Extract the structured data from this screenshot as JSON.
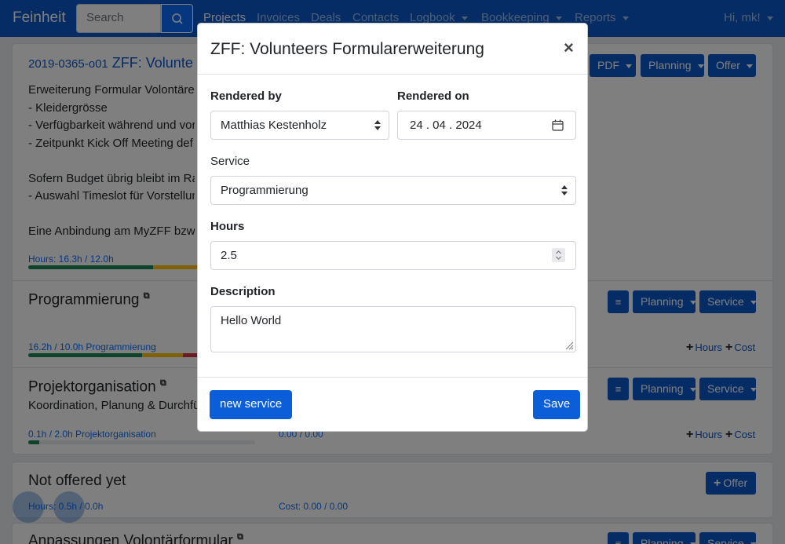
{
  "navbar": {
    "brand": "Feinheit",
    "search_placeholder": "Search",
    "links": [
      "Projects",
      "Invoices",
      "Deals",
      "Contacts",
      "Logbook",
      "Bookkeeping",
      "Reports"
    ],
    "user": "Hi, mk!"
  },
  "project": {
    "code": "2019-0365-o01",
    "title": "ZFF: Volunteers Formularerweiterung",
    "title_visible": "ZFF: Volunte",
    "description_lines": [
      "Erweiterung Formular Volontäre",
      "- Kleidergrösse",
      "- Verfügbarkeit während und vor",
      "- Zeitpunkt Kick Off Meeting def",
      "",
      "Sofern Budget übrig bleibt im Ra",
      "- Auswahl Timeslot für Vorstellun",
      "",
      "Eine Anbindung am MyZFF bzw."
    ],
    "hours": "Hours: 16.3h / 12.0h",
    "buttons": {
      "pdf": "PDF",
      "planning": "Planning",
      "offer": "Offer"
    }
  },
  "services": [
    {
      "title": "Programmierung",
      "hours_text": "16.2h / 10.0h Programmierung",
      "planning": "Planning",
      "service": "Service",
      "add_hours": "Hours",
      "add_cost": "Cost"
    },
    {
      "title": "Projektorganisation",
      "subtitle": "Koordination, Planung & Durchfü",
      "hours_text": "0.1h / 2.0h Projektorganisation",
      "cost_text": "0.00 / 0.00",
      "planning": "Planning",
      "service": "Service",
      "add_hours": "Hours",
      "add_cost": "Cost"
    }
  ],
  "not_offered": {
    "title": "Not offered yet",
    "hours": "Hours: 0.5h / 0.0h",
    "cost": "Cost: 0.00 / 0.00",
    "offer_button": "Offer"
  },
  "last_row": {
    "title": "Anpassungen Volontärformular",
    "planning": "Planning",
    "service": "Service"
  },
  "modal": {
    "title": "ZFF: Volunteers Formularerweiterung",
    "close": "×",
    "rendered_by_label": "Rendered by",
    "rendered_by_value": "Matthias Kestenholz",
    "rendered_on_label": "Rendered on",
    "rendered_on_value": "24 . 04 . 2024",
    "service_label": "Service",
    "service_value": "Programmierung",
    "hours_label": "Hours",
    "hours_value": "2.5",
    "description_label": "Description",
    "description_value": "Hello World",
    "new_service_button": "new service",
    "save_button": "Save"
  },
  "colors": {
    "primary": "#0a58ca",
    "success": "#198754",
    "warning": "#ffc107",
    "danger": "#dc3545"
  },
  "progress": {
    "project": [
      0.55,
      0.2,
      0.25
    ],
    "programmierung": [
      0.5,
      0.18,
      0.32
    ],
    "projektorganisation": [
      0.05,
      0,
      0
    ]
  }
}
